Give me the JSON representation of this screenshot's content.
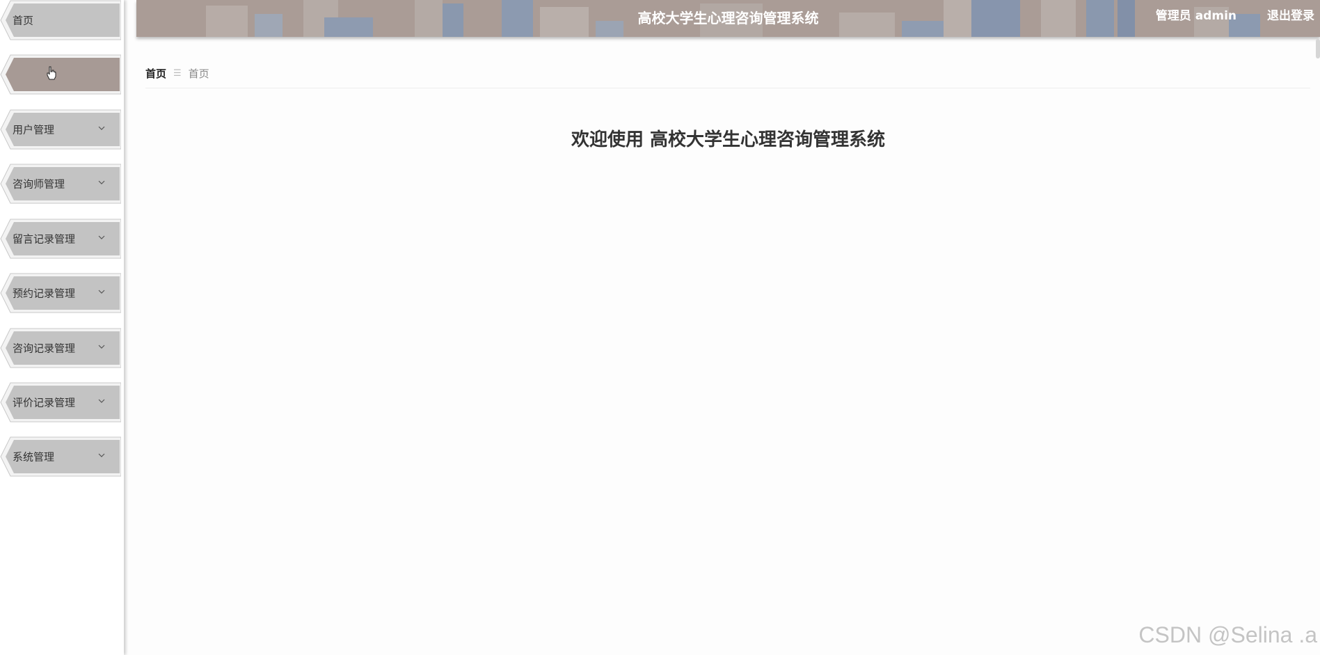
{
  "header": {
    "title": "高校大学生心理咨询管理系统",
    "user": "管理员 admin",
    "logout": "退出登录",
    "background_color": "#aa9c96"
  },
  "sidebar": {
    "items": [
      {
        "label": "首页",
        "has_chevron": false,
        "active": false
      },
      {
        "label": "",
        "has_chevron": false,
        "active": true
      },
      {
        "label": "用户管理",
        "has_chevron": true,
        "active": false
      },
      {
        "label": "咨询师管理",
        "has_chevron": true,
        "active": false
      },
      {
        "label": "留言记录管理",
        "has_chevron": true,
        "active": false
      },
      {
        "label": "预约记录管理",
        "has_chevron": true,
        "active": false
      },
      {
        "label": "咨询记录管理",
        "has_chevron": true,
        "active": false
      },
      {
        "label": "评价记录管理",
        "has_chevron": true,
        "active": false
      },
      {
        "label": "系统管理",
        "has_chevron": true,
        "active": false
      }
    ],
    "item_color": "#c3c3c3",
    "active_color": "#a79a95"
  },
  "breadcrumb": {
    "home": "首页",
    "separator": "☰",
    "current": "首页"
  },
  "main": {
    "welcome": "欢迎使用 高校大学生心理咨询管理系统"
  },
  "watermark": "CSDN @Selina .a"
}
